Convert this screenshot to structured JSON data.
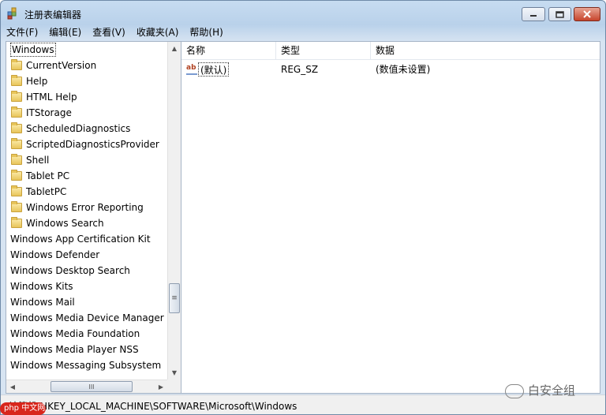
{
  "window": {
    "title": "注册表编辑器"
  },
  "menu": [
    "文件(F)",
    "编辑(E)",
    "查看(V)",
    "收藏夹(A)",
    "帮助(H)"
  ],
  "tree": {
    "items": [
      {
        "label": "Windows",
        "folder": false,
        "indent": 0,
        "selected": true
      },
      {
        "label": "CurrentVersion",
        "folder": true,
        "indent": 1
      },
      {
        "label": "Help",
        "folder": true,
        "indent": 1
      },
      {
        "label": "HTML Help",
        "folder": true,
        "indent": 1
      },
      {
        "label": "ITStorage",
        "folder": true,
        "indent": 1
      },
      {
        "label": "ScheduledDiagnostics",
        "folder": true,
        "indent": 1
      },
      {
        "label": "ScriptedDiagnosticsProvider",
        "folder": true,
        "indent": 1
      },
      {
        "label": "Shell",
        "folder": true,
        "indent": 1
      },
      {
        "label": "Tablet PC",
        "folder": true,
        "indent": 1
      },
      {
        "label": "TabletPC",
        "folder": true,
        "indent": 1
      },
      {
        "label": "Windows Error Reporting",
        "folder": true,
        "indent": 1
      },
      {
        "label": "Windows Search",
        "folder": true,
        "indent": 1
      },
      {
        "label": "Windows App Certification Kit",
        "folder": false,
        "indent": 0
      },
      {
        "label": "Windows Defender",
        "folder": false,
        "indent": 0
      },
      {
        "label": "Windows Desktop Search",
        "folder": false,
        "indent": 0
      },
      {
        "label": "Windows Kits",
        "folder": false,
        "indent": 0
      },
      {
        "label": "Windows Mail",
        "folder": false,
        "indent": 0
      },
      {
        "label": "Windows Media Device Manager",
        "folder": false,
        "indent": 0
      },
      {
        "label": "Windows Media Foundation",
        "folder": false,
        "indent": 0
      },
      {
        "label": "Windows Media Player NSS",
        "folder": false,
        "indent": 0
      },
      {
        "label": "Windows Messaging Subsystem",
        "folder": false,
        "indent": 0
      }
    ],
    "hscroll_thumb_glyph": "III",
    "vscroll_thumb_glyph": "≡"
  },
  "list": {
    "columns": [
      "名称",
      "类型",
      "数据"
    ],
    "rows": [
      {
        "name": "(默认)",
        "type": "REG_SZ",
        "data": "(数值未设置)",
        "icon": "string-value-icon"
      }
    ]
  },
  "status": {
    "path": "计算机\\HKEY_LOCAL_MACHINE\\SOFTWARE\\Microsoft\\Windows"
  },
  "watermark": {
    "text": "白安全组",
    "logo": "php 中文网"
  },
  "colors": {
    "selected_bg": "#ffffff",
    "title_gradient_top": "#c7dcf1",
    "close_red": "#c7442c"
  }
}
